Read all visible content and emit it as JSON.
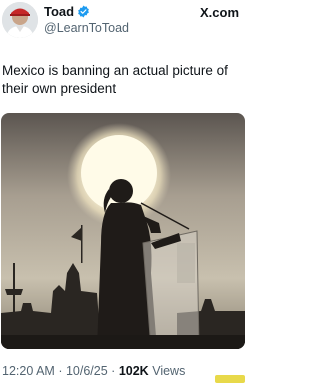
{
  "header": {
    "name": "Toad",
    "handle": "@LearnToToad",
    "site": "X.com"
  },
  "tweet": {
    "text": "Mexico is banning an actual picture of their own president"
  },
  "footer": {
    "time": "12:20 AM",
    "date": "10/6/25",
    "views_count": "102K",
    "views_label": "Views",
    "separator": "·"
  },
  "colors": {
    "verified": "#1d9bf0",
    "secondary_text": "#536471"
  }
}
